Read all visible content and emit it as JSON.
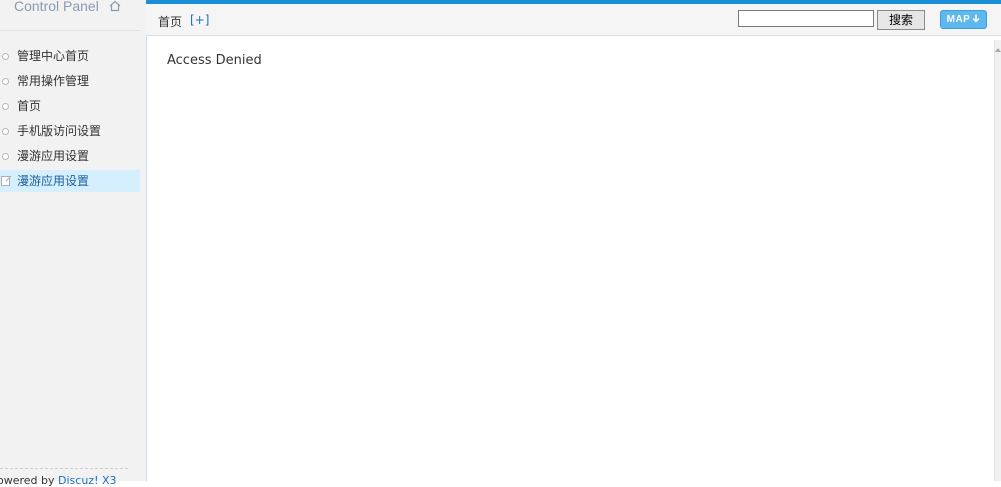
{
  "brand": {
    "title": "Control Panel",
    "icon": "home-icon"
  },
  "sidebar": {
    "items": [
      {
        "label": "管理中心首页"
      },
      {
        "label": "常用操作管理"
      },
      {
        "label": "首页"
      },
      {
        "label": "手机版访问设置"
      },
      {
        "label": "漫游应用设置"
      },
      {
        "label": "漫游应用设置",
        "active": true,
        "icon": "edit-icon"
      }
    ],
    "footer_prefix": "owered by ",
    "footer_link": "Discuz! X3"
  },
  "topbar": {
    "breadcrumb": "首页",
    "add_label": "[+]",
    "search_value": "",
    "search_button": "搜索",
    "map_button": "MAP"
  },
  "main": {
    "message": "Access Denied"
  },
  "colors": {
    "accent": "#1b8ed8",
    "active_bg": "#d6efff",
    "link": "#1a6fc0",
    "map_button": "#5eb8ee"
  }
}
